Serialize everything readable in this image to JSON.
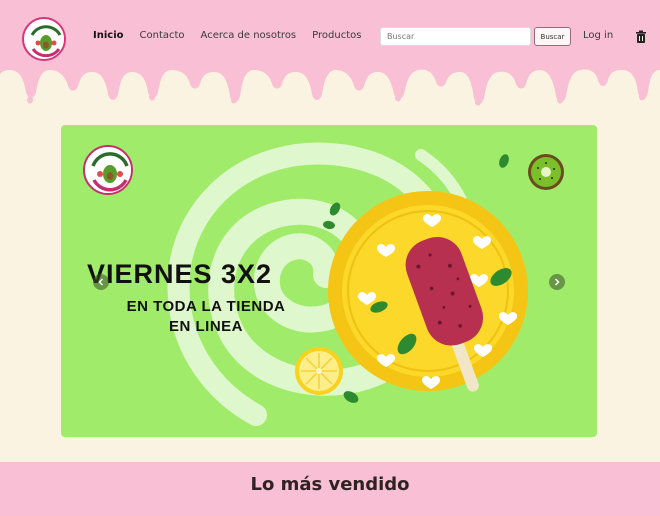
{
  "header": {
    "brand_colors": {
      "pink": "#f9bfd4",
      "cream": "#fbf3e2",
      "accent": "#d8347a"
    },
    "logo_icon": "avocado-logo",
    "nav": [
      {
        "label": "Inicio",
        "active": true
      },
      {
        "label": "Contacto",
        "active": false
      },
      {
        "label": "Acerca de nosotros",
        "active": false
      },
      {
        "label": "Productos",
        "active": false
      }
    ],
    "search": {
      "placeholder": "Buscar",
      "button_label": "Buscar"
    },
    "login_label": "Log in",
    "cart_icon": "trash-icon"
  },
  "banner": {
    "background_color": "#a0ec6a",
    "headline": "VIERNES 3X2",
    "subline": "EN TODA LA TIENDA EN LINEA",
    "prev_icon": "chevron-left-icon",
    "next_icon": "chevron-right-icon"
  },
  "bestsellers": {
    "title": "Lo más vendido"
  }
}
